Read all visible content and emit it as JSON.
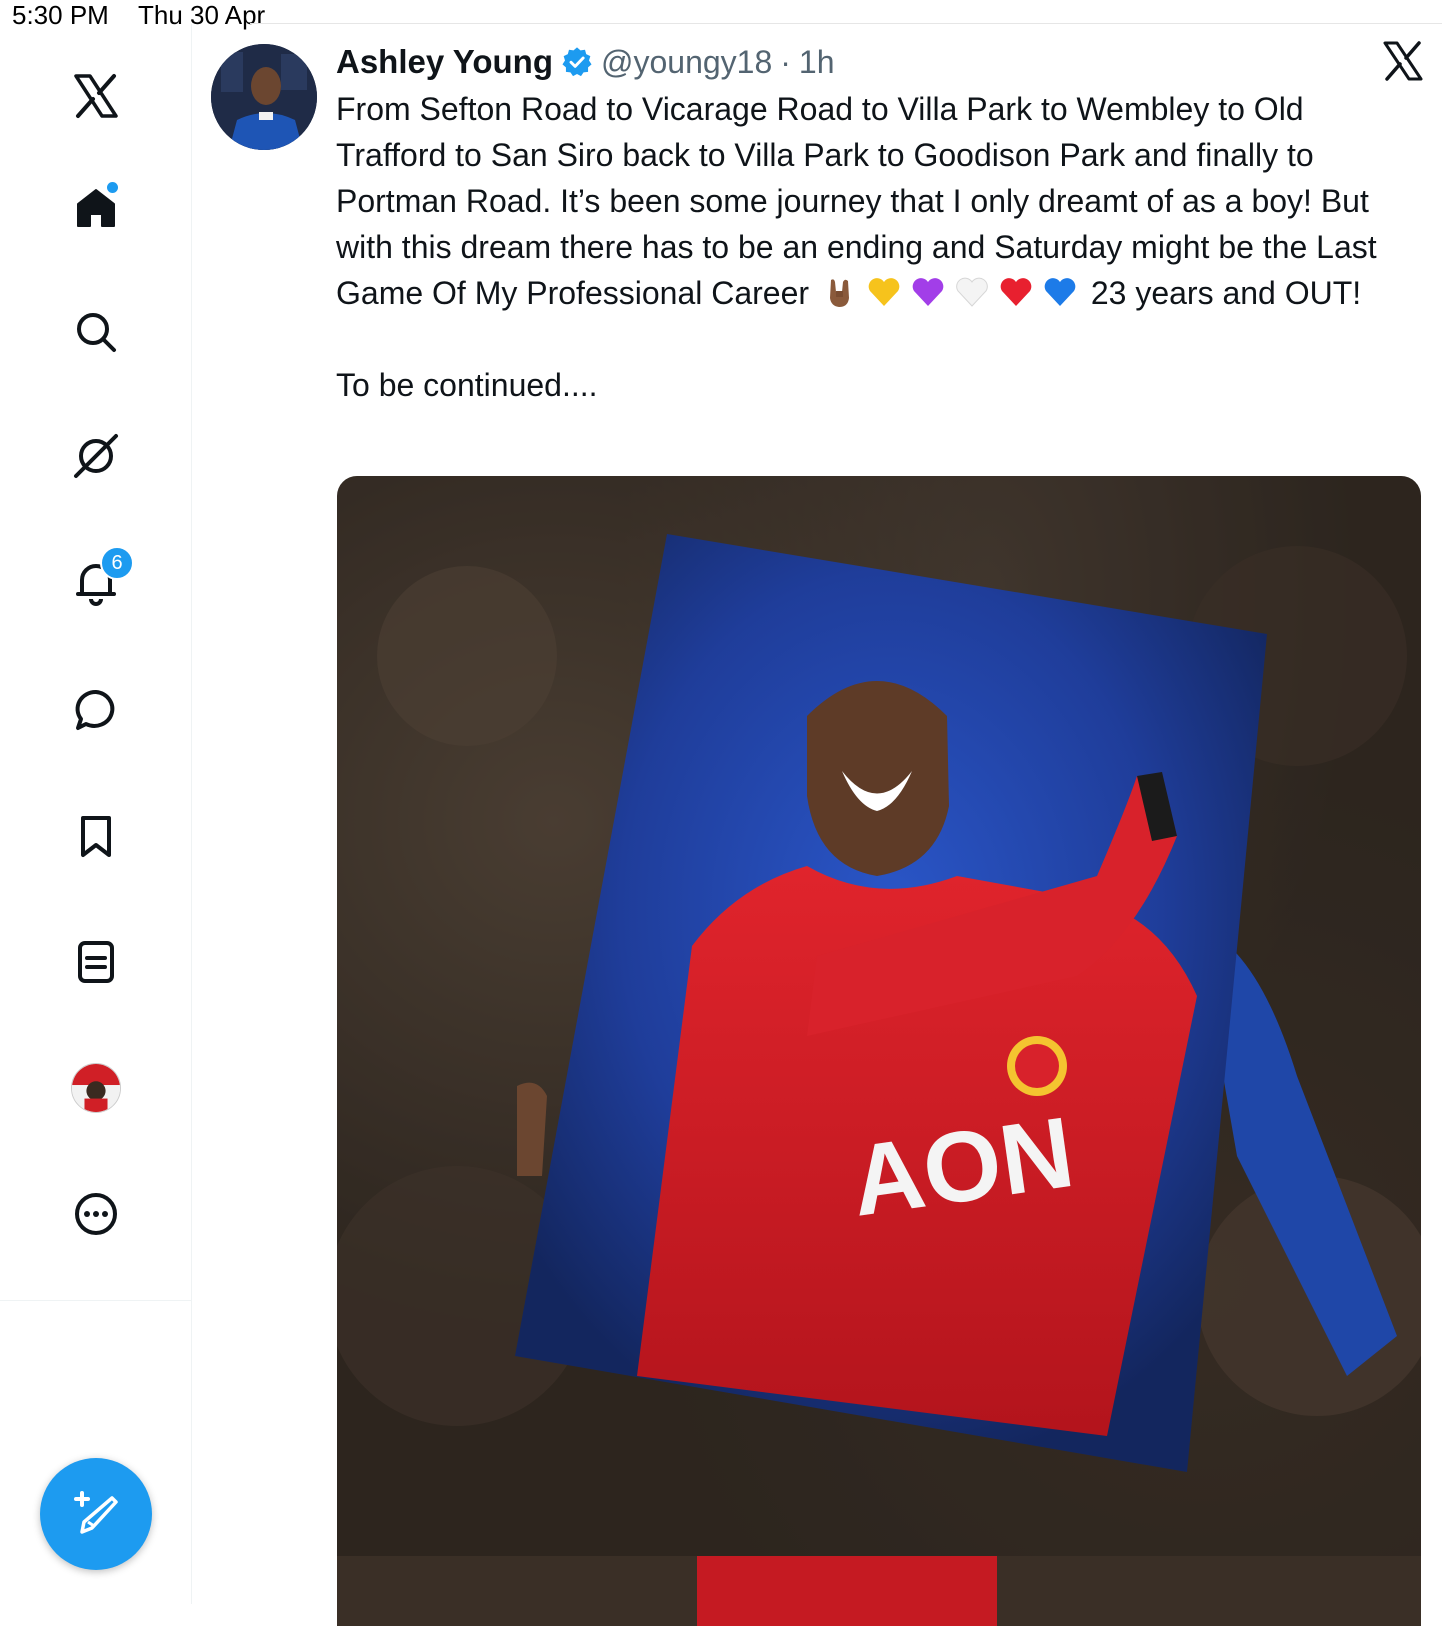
{
  "status_bar": {
    "time": "5:30 PM",
    "date": "Thu 30 Apr"
  },
  "sidebar": {
    "items": [
      {
        "name": "x-logo-icon"
      },
      {
        "name": "home-icon",
        "has_dot": true
      },
      {
        "name": "search-icon"
      },
      {
        "name": "grok-icon"
      },
      {
        "name": "notifications-icon",
        "badge": "6"
      },
      {
        "name": "messages-icon"
      },
      {
        "name": "bookmarks-icon"
      },
      {
        "name": "lists-icon"
      },
      {
        "name": "profile-avatar"
      },
      {
        "name": "more-icon"
      }
    ],
    "compose_icon": "compose-plus-feather-icon",
    "accent_color": "#1d9bf0"
  },
  "tweet": {
    "author_name": "Ashley Young",
    "verified": true,
    "handle": "@youngy18",
    "separator": "·",
    "time": "1h",
    "text_main": "From Sefton Road to Vicarage Road to Villa Park to Wembley to Old Trafford to San Siro back to Villa Park to Goodison Park and finally to Portman Road. It’s been some journey that I only dreamt of as a boy! But with this dream there has to be an ending and Saturday might be the Last Game Of My Professional Career",
    "emojis": [
      "rock-hand",
      "yellow-heart",
      "purple-heart",
      "white-heart",
      "red-heart",
      "blue-heart"
    ],
    "text_after": "23 years and OUT!",
    "text_continued": "To be continued....",
    "shirt_sponsor": "AON"
  },
  "colors": {
    "text": "#0f1419",
    "secondary_text": "#536471",
    "verified": "#1d9bf0",
    "shirt_red": "#d01f26",
    "photo_blue": "#1f3d9a"
  }
}
